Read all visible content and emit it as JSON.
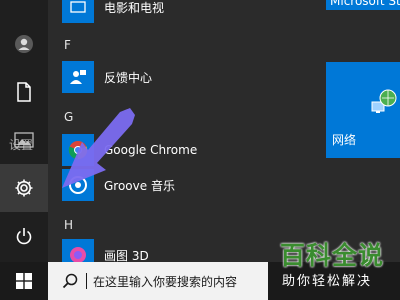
{
  "start_menu": {
    "rail": {
      "settings_tooltip": "设置"
    },
    "app_list": {
      "groups": [
        {
          "letter": "F",
          "apps": [
            {
              "name": "反馈中心",
              "icon": "feedback-hub-icon"
            }
          ]
        },
        {
          "letter": "G",
          "apps": [
            {
              "name": "Google Chrome",
              "icon": "chrome-icon"
            },
            {
              "name": "Groove 音乐",
              "icon": "groove-music-icon"
            }
          ]
        },
        {
          "letter": "H",
          "apps": [
            {
              "name": "画图 3D",
              "icon": "paint-3d-icon"
            }
          ]
        }
      ],
      "top_partial_app": {
        "name": "电影和电视",
        "icon": "movies-tv-icon"
      }
    },
    "tiles": {
      "store_label": "Microsoft Sto",
      "network_label": "网络"
    }
  },
  "taskbar": {
    "search_placeholder": "在这里输入你要搜索的内容"
  },
  "watermark": {
    "title": "百科全说",
    "subtitle": "助你轻松解决"
  },
  "colors": {
    "accent": "#0078d7",
    "arrow": "#7b6cf0",
    "watermark_green": "#3a8c2f"
  }
}
